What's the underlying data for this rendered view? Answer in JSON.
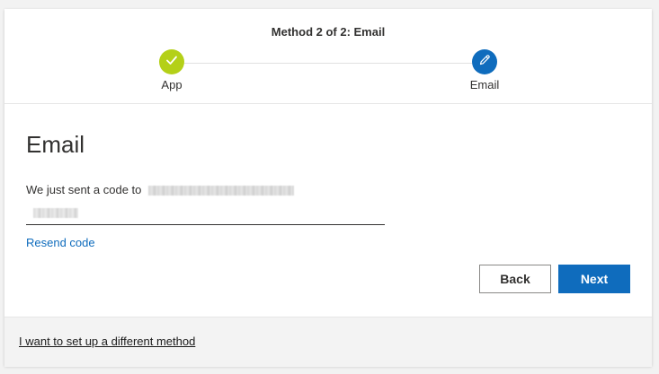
{
  "header": {
    "method_title": "Method 2 of 2: Email",
    "steps": [
      {
        "label": "App",
        "state": "complete",
        "icon": "check-icon",
        "color": "#b4d018"
      },
      {
        "label": "Email",
        "state": "current",
        "icon": "pencil-icon",
        "color": "#0f6cbd"
      }
    ]
  },
  "main": {
    "section_title": "Email",
    "sent_text": "We just sent a code to",
    "code_input": {
      "value": "",
      "placeholder": ""
    },
    "resend_label": "Resend code",
    "back_label": "Back",
    "next_label": "Next"
  },
  "footer": {
    "different_method_label": "I want to set up a different method"
  },
  "colors": {
    "accent": "#0f6cbd",
    "complete": "#b4d018",
    "link": "#0f6cbd"
  }
}
